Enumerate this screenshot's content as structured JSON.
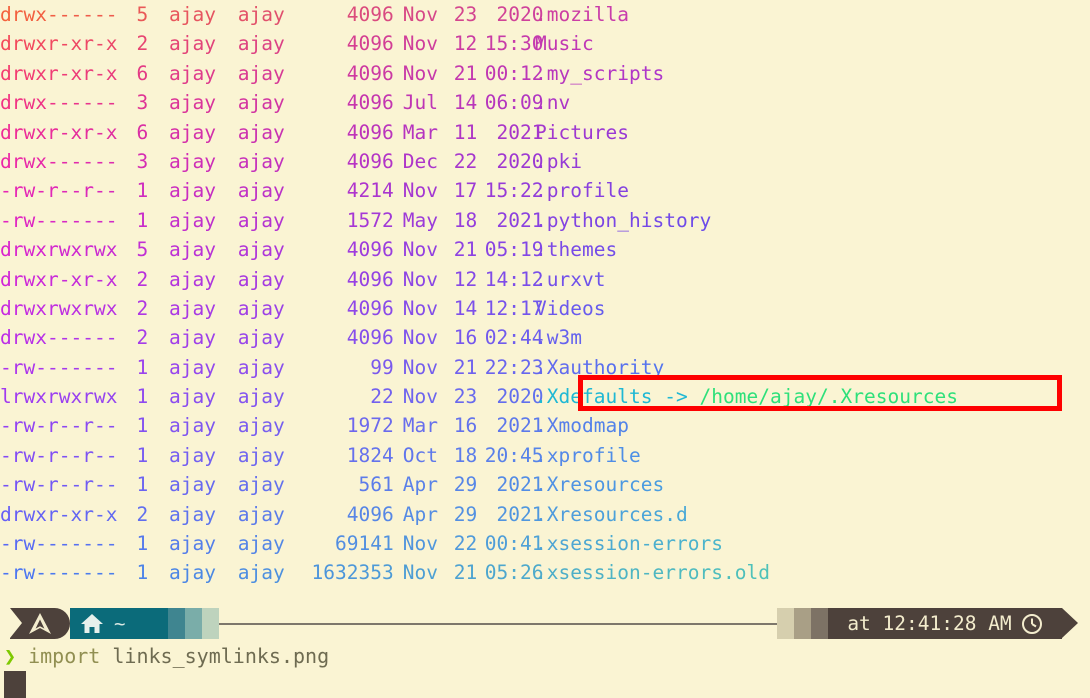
{
  "terminal": {
    "background": "#faf4d3",
    "highlight_color": "#fe0000",
    "font_size_px": 19.5
  },
  "listing": {
    "columns": [
      "permissions",
      "links",
      "user",
      "group",
      "size",
      "month",
      "day",
      "time",
      "name"
    ],
    "rows": [
      {
        "permissions": "drwx------",
        "links": "5",
        "user": "ajay",
        "group": "ajay",
        "size": "4096",
        "month": "Nov",
        "day": "23",
        "time": "2020",
        "name": ".mozilla",
        "link_target": "",
        "start_color": "#f4613c",
        "end_color": "#b42ae0"
      },
      {
        "permissions": "drwxr-xr-x",
        "links": "2",
        "user": "ajay",
        "group": "ajay",
        "size": "4096",
        "month": "Nov",
        "day": "12",
        "time": "15:30",
        "name": "Music",
        "link_target": "",
        "start_color": "#f44a5a",
        "end_color": "#a32ee8"
      },
      {
        "permissions": "drwxr-xr-x",
        "links": "6",
        "user": "ajay",
        "group": "ajay",
        "size": "4096",
        "month": "Nov",
        "day": "21",
        "time": "00:12",
        "name": ".my_scripts",
        "link_target": "",
        "start_color": "#f43d70",
        "end_color": "#9333ec"
      },
      {
        "permissions": "drwx------",
        "links": "3",
        "user": "ajay",
        "group": "ajay",
        "size": "4096",
        "month": "Jul",
        "day": "14",
        "time": "06:09",
        "name": ".nv",
        "link_target": "",
        "start_color": "#f23383",
        "end_color": "#8238ef"
      },
      {
        "permissions": "drwxr-xr-x",
        "links": "6",
        "user": "ajay",
        "group": "ajay",
        "size": "4096",
        "month": "Mar",
        "day": "11",
        "time": "2021",
        "name": "Pictures",
        "link_target": "",
        "start_color": "#ef2c96",
        "end_color": "#713ef1"
      },
      {
        "permissions": "drwx------",
        "links": "3",
        "user": "ajay",
        "group": "ajay",
        "size": "4096",
        "month": "Dec",
        "day": "22",
        "time": "2020",
        "name": ".pki",
        "link_target": "",
        "start_color": "#ec28a6",
        "end_color": "#6245f3"
      },
      {
        "permissions": "-rw-r--r--",
        "links": "1",
        "user": "ajay",
        "group": "ajay",
        "size": "4214",
        "month": "Nov",
        "day": "17",
        "time": "15:22",
        "name": ".profile",
        "link_target": "",
        "start_color": "#e725b4",
        "end_color": "#554df4"
      },
      {
        "permissions": "-rw-------",
        "links": "1",
        "user": "ajay",
        "group": "ajay",
        "size": "1572",
        "month": "May",
        "day": "18",
        "time": "2021",
        "name": ".python_history",
        "link_target": "",
        "start_color": "#e124c1",
        "end_color": "#4a56f5"
      },
      {
        "permissions": "drwxrwxrwx",
        "links": "5",
        "user": "ajay",
        "group": "ajay",
        "size": "4096",
        "month": "Nov",
        "day": "21",
        "time": "05:19",
        "name": ".themes",
        "link_target": "",
        "start_color": "#da24cd",
        "end_color": "#4160f6"
      },
      {
        "permissions": "drwxr-xr-x",
        "links": "2",
        "user": "ajay",
        "group": "ajay",
        "size": "4096",
        "month": "Nov",
        "day": "12",
        "time": "14:12",
        "name": ".urxvt",
        "link_target": "",
        "start_color": "#d126d7",
        "end_color": "#3a6af5"
      },
      {
        "permissions": "drwxrwxrwx",
        "links": "2",
        "user": "ajay",
        "group": "ajay",
        "size": "4096",
        "month": "Nov",
        "day": "14",
        "time": "12:17",
        "name": "Videos",
        "link_target": "",
        "start_color": "#c72ae0",
        "end_color": "#3575f4"
      },
      {
        "permissions": "drwx------",
        "links": "2",
        "user": "ajay",
        "group": "ajay",
        "size": "4096",
        "month": "Nov",
        "day": "16",
        "time": "02:44",
        "name": ".w3m",
        "link_target": "",
        "start_color": "#bc2ee7",
        "end_color": "#3280f2"
      },
      {
        "permissions": "-rw-------",
        "links": "1",
        "user": "ajay",
        "group": "ajay",
        "size": "99",
        "month": "Nov",
        "day": "21",
        "time": "22:23",
        "name": ".Xauthority",
        "link_target": "",
        "start_color": "#af34ec",
        "end_color": "#318cef"
      },
      {
        "permissions": "lrwxrwxrwx",
        "links": "1",
        "user": "ajay",
        "group": "ajay",
        "size": "22",
        "month": "Nov",
        "day": "23",
        "time": "2020",
        "name": ".Xdefaults",
        "link_target": "/home/ajay/.Xresources",
        "start_color": "#a13af0",
        "end_color": "#3297eb",
        "highlight": true,
        "name_color": "#1fb8d4",
        "target_color": "#2ee07a"
      },
      {
        "permissions": "-rw-r--r--",
        "links": "1",
        "user": "ajay",
        "group": "ajay",
        "size": "1972",
        "month": "Mar",
        "day": "16",
        "time": "2021",
        "name": ".Xmodmap",
        "link_target": "",
        "start_color": "#9341f3",
        "end_color": "#33a2e5"
      },
      {
        "permissions": "-rw-r--r--",
        "links": "1",
        "user": "ajay",
        "group": "ajay",
        "size": "1824",
        "month": "Oct",
        "day": "18",
        "time": "20:45",
        "name": ".xprofile",
        "link_target": "",
        "start_color": "#844af5",
        "end_color": "#36ade0"
      },
      {
        "permissions": "-rw-r--r--",
        "links": "1",
        "user": "ajay",
        "group": "ajay",
        "size": "561",
        "month": "Apr",
        "day": "29",
        "time": "2021",
        "name": ".Xresources",
        "link_target": "",
        "start_color": "#7553f6",
        "end_color": "#39b7d8"
      },
      {
        "permissions": "drwxr-xr-x",
        "links": "2",
        "user": "ajay",
        "group": "ajay",
        "size": "4096",
        "month": "Apr",
        "day": "29",
        "time": "2021",
        "name": ".Xresources.d",
        "link_target": "",
        "start_color": "#665ef6",
        "end_color": "#3fc0cd"
      },
      {
        "permissions": "-rw-------",
        "links": "1",
        "user": "ajay",
        "group": "ajay",
        "size": "69141",
        "month": "Nov",
        "day": "22",
        "time": "00:41",
        "name": ".xsession-errors",
        "link_target": "",
        "start_color": "#5869f5",
        "end_color": "#47c9c0"
      },
      {
        "permissions": "-rw-------",
        "links": "1",
        "user": "ajay",
        "group": "ajay",
        "size": "1632353",
        "month": "Nov",
        "day": "21",
        "time": "05:26",
        "name": ".xsession-errors.old",
        "link_target": "",
        "start_color": "#4b74f3",
        "end_color": "#4fd0af"
      }
    ],
    "symlink_arrow": "->"
  },
  "prompt_bar": {
    "logo": "arch-linux-logo",
    "home_icon": "home-icon",
    "path": "~",
    "clock_icon": "clock-icon",
    "time_label": "at 12:41:28 AM",
    "colors": {
      "logo_segment": "#4d413b",
      "path_segment": "#0b6b7a",
      "time_segment": "#4d413b",
      "rule": "#7d776b"
    }
  },
  "command_line": {
    "chevron": "❯",
    "command": "import ",
    "argument": "links_symlinks.png"
  }
}
